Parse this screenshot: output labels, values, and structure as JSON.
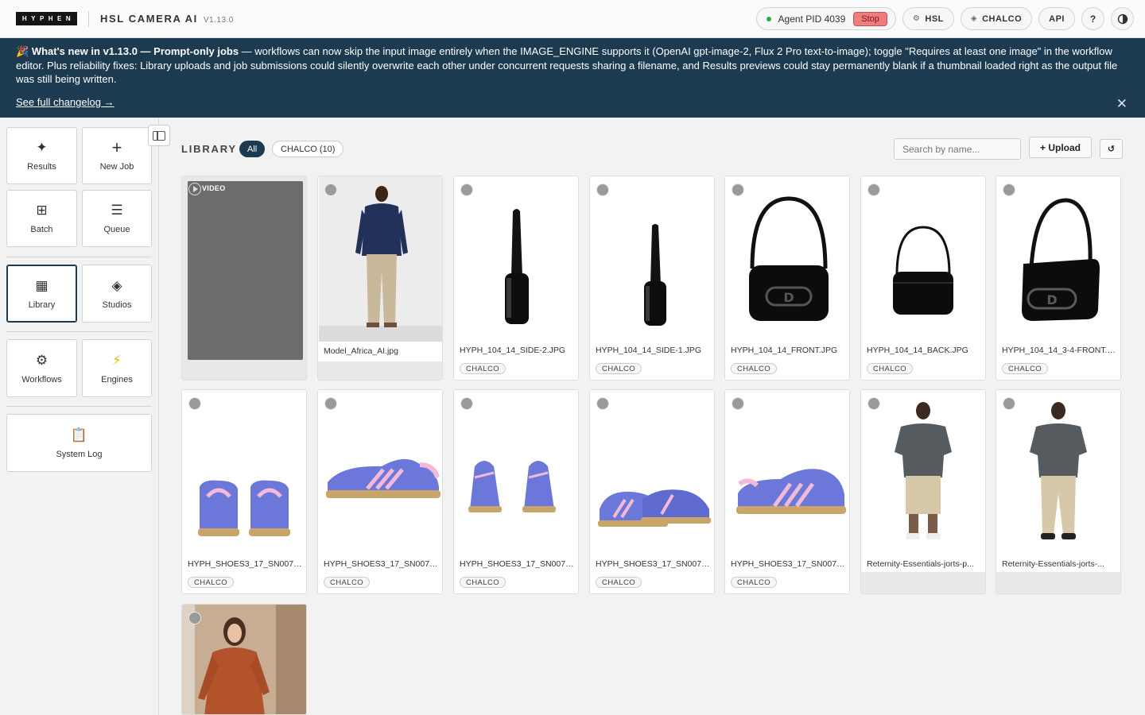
{
  "header": {
    "logo_text": "HYPHEN",
    "app_name": "HSL CAMERA AI",
    "version": "V1.13.0",
    "agent_status": "Agent PID 4039",
    "stop_label": "Stop",
    "pills": [
      {
        "icon": "gear-icon",
        "label": "HSL"
      },
      {
        "icon": "diamond-icon",
        "label": "CHALCO"
      },
      {
        "icon": "",
        "label": "API"
      }
    ],
    "help_label": "?",
    "theme_icon": "contrast-icon"
  },
  "banner": {
    "emoji": "🎉",
    "headline": "What's new in v1.13.0 — Prompt-only jobs",
    "body": " — workflows can now skip the input image entirely when the IMAGE_ENGINE supports it (OpenAI gpt-image-2, Flux 2 Pro text-to-image); toggle \"Requires at least one image\" in the workflow editor. Plus reliability fixes: Library uploads and job submissions could silently overwrite each other under concurrent requests sharing a filename, and Results previews could stay permanently blank if a thumbnail loaded right as the output file was still being written.",
    "link": "See full changelog →",
    "close": "✕"
  },
  "sidebar": {
    "items": [
      {
        "icon": "sparkle-icon",
        "glyph": "✦",
        "label": "Results"
      },
      {
        "icon": "plus-icon",
        "glyph": "+",
        "label": "New Job"
      },
      {
        "icon": "grid-icon",
        "glyph": "⊞",
        "label": "Batch"
      },
      {
        "icon": "list-icon",
        "glyph": "☰",
        "label": "Queue"
      },
      {
        "icon": "library-grid-icon",
        "glyph": "▦",
        "label": "Library"
      },
      {
        "icon": "diamond-icon",
        "glyph": "◈",
        "label": "Studios"
      },
      {
        "icon": "gear-icon",
        "glyph": "⚙",
        "label": "Workflows"
      },
      {
        "icon": "lightning-icon",
        "glyph": "⚡",
        "label": "Engines"
      },
      {
        "icon": "clipboard-icon",
        "glyph": "📋",
        "label": "System Log"
      }
    ],
    "active": "Library"
  },
  "library": {
    "title": "LIBRARY",
    "filters": {
      "all": "All",
      "chalco": "CHALCO (10)"
    },
    "search_placeholder": "Search by name...",
    "upload_label": "+ Upload",
    "refresh_glyph": "↺",
    "items": [
      {
        "name": "",
        "tag": "",
        "kind": "video",
        "video_label": "VIDEO"
      },
      {
        "name": "Model_Africa_AI.jpg",
        "tag": "",
        "kind": "model-man"
      },
      {
        "name": "HYPH_104_14_SIDE-2.JPG",
        "tag": "CHALCO",
        "kind": "bag-side"
      },
      {
        "name": "HYPH_104_14_SIDE-1.JPG",
        "tag": "CHALCO",
        "kind": "bag-side-small"
      },
      {
        "name": "HYPH_104_14_FRONT.JPG",
        "tag": "CHALCO",
        "kind": "bag-front"
      },
      {
        "name": "HYPH_104_14_BACK.JPG",
        "tag": "CHALCO",
        "kind": "bag-back"
      },
      {
        "name": "HYPH_104_14_3-4-FRONT.JPG",
        "tag": "CHALCO",
        "kind": "bag-34"
      },
      {
        "name": "HYPH_SHOES3_17_SN0074...",
        "tag": "CHALCO",
        "kind": "shoes-back"
      },
      {
        "name": "HYPH_SHOES3_17_SN0074...",
        "tag": "CHALCO",
        "kind": "shoe-side"
      },
      {
        "name": "HYPH_SHOES3_17_SN0074...",
        "tag": "CHALCO",
        "kind": "shoes-front"
      },
      {
        "name": "HYPH_SHOES3_17_SN0074...",
        "tag": "CHALCO",
        "kind": "shoes-pair"
      },
      {
        "name": "HYPH_SHOES3_17_SN0074...",
        "tag": "CHALCO",
        "kind": "shoe-side2"
      },
      {
        "name": "Reternity-Essentials-jorts-p...",
        "tag": "",
        "kind": "man-tee"
      },
      {
        "name": "Reternity-Essentials-jorts-...",
        "tag": "",
        "kind": "man-tee2"
      },
      {
        "name": "",
        "tag": "",
        "kind": "woman-dress"
      }
    ]
  }
}
